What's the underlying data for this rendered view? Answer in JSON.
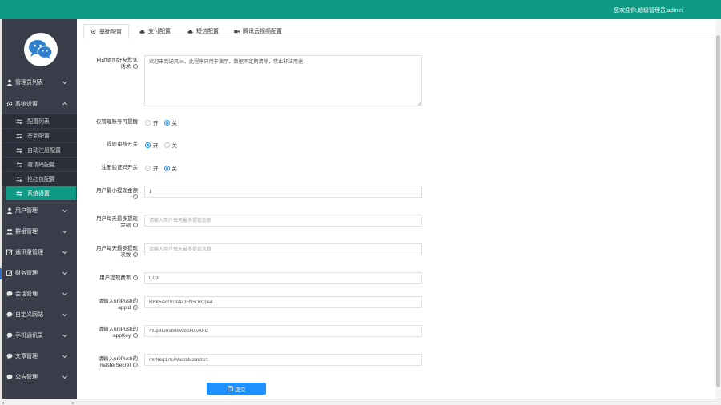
{
  "header": {
    "welcome": "您欢迎你,超级管理员:admin",
    "bg_color": "#0f9a86"
  },
  "sidebar": {
    "bg_color": "#393d49",
    "active_color": "#0f9a86",
    "logo_icon": "wechat-logo",
    "groups": [
      {
        "label": "管理员列表",
        "icon": "user-icon",
        "expanded": false
      },
      {
        "label": "系统设置",
        "icon": "gear-icon",
        "expanded": true,
        "children": [
          {
            "label": "配置列表",
            "icon": "sliders-icon"
          },
          {
            "label": "签到配置",
            "icon": "sliders-icon"
          },
          {
            "label": "自动注册配置",
            "icon": "sliders-icon"
          },
          {
            "label": "邀请码配置",
            "icon": "sliders-icon"
          },
          {
            "label": "抢红包配置",
            "icon": "sliders-icon"
          },
          {
            "label": "系统设置",
            "icon": "sliders-icon",
            "active": true
          }
        ]
      },
      {
        "label": "用户管理",
        "icon": "user-icon",
        "expanded": false
      },
      {
        "label": "群组管理",
        "icon": "users-icon",
        "expanded": false
      },
      {
        "label": "通讯录管理",
        "icon": "edit-icon",
        "expanded": false
      },
      {
        "label": "财务管理",
        "icon": "edit-icon",
        "expanded": false
      },
      {
        "label": "会话管理",
        "icon": "chat-icon",
        "expanded": false
      },
      {
        "label": "自定义网站",
        "icon": "chat-icon",
        "expanded": false
      },
      {
        "label": "手机通讯录",
        "icon": "chat-icon",
        "expanded": false
      },
      {
        "label": "文章管理",
        "icon": "chat-icon",
        "expanded": false
      },
      {
        "label": "公告管理",
        "icon": "chat-icon",
        "expanded": false
      }
    ]
  },
  "tabs": [
    {
      "label": "基础配置",
      "icon": "gear-icon",
      "active": true
    },
    {
      "label": "支付配置",
      "icon": "cloud-icon",
      "active": false
    },
    {
      "label": "短信配置",
      "icon": "cloud-icon",
      "active": false
    },
    {
      "label": "腾讯云视频配置",
      "icon": "video-icon",
      "active": false
    }
  ],
  "form": {
    "intro": {
      "label": "自动添加好友默认话术",
      "value": "欢迎来到逆风im，此程序只用于演示，数据不定期清除，禁止非法用途！"
    },
    "admin_only_add": {
      "label": "仅管理账号可提醒",
      "options": [
        "开",
        "关"
      ],
      "selected": "关"
    },
    "withdraw_audit": {
      "label": "提现审核开关",
      "options": [
        "开",
        "关"
      ],
      "selected": "开"
    },
    "register_verify": {
      "label": "注册验证码开关",
      "options": [
        "开",
        "关"
      ],
      "selected": "关"
    },
    "min_withdraw": {
      "label": "用户最小提现金额",
      "value": "1",
      "placeholder": ""
    },
    "max_withdraw_amount": {
      "label": "用户每天最多提现金额",
      "value": "",
      "placeholder": "请输入用户每天最多提现金额"
    },
    "max_withdraw_times": {
      "label": "用户每天最多提现次数",
      "value": "",
      "placeholder": "请输入用户每天最多提现次数"
    },
    "withdraw_rate": {
      "label": "用户提现费率",
      "value": "0.03",
      "placeholder": ""
    },
    "unipush_appid": {
      "label": "请输入uniPush的appid",
      "value": "RBK54x0SUn4xJFN5DxCpe4",
      "placeholder": ""
    },
    "unipush_appkey": {
      "label": "请输入uniPush的appKey",
      "value": "4IupBluRsb98WbSHXvXFC",
      "placeholder": ""
    },
    "unipush_master": {
      "label": "请输入uniPush的masterSecret",
      "value": "m0Neq17tUANcrbM3aUIU1",
      "placeholder": ""
    },
    "submit_label": "提交"
  },
  "accent_color": "#1e90ff"
}
